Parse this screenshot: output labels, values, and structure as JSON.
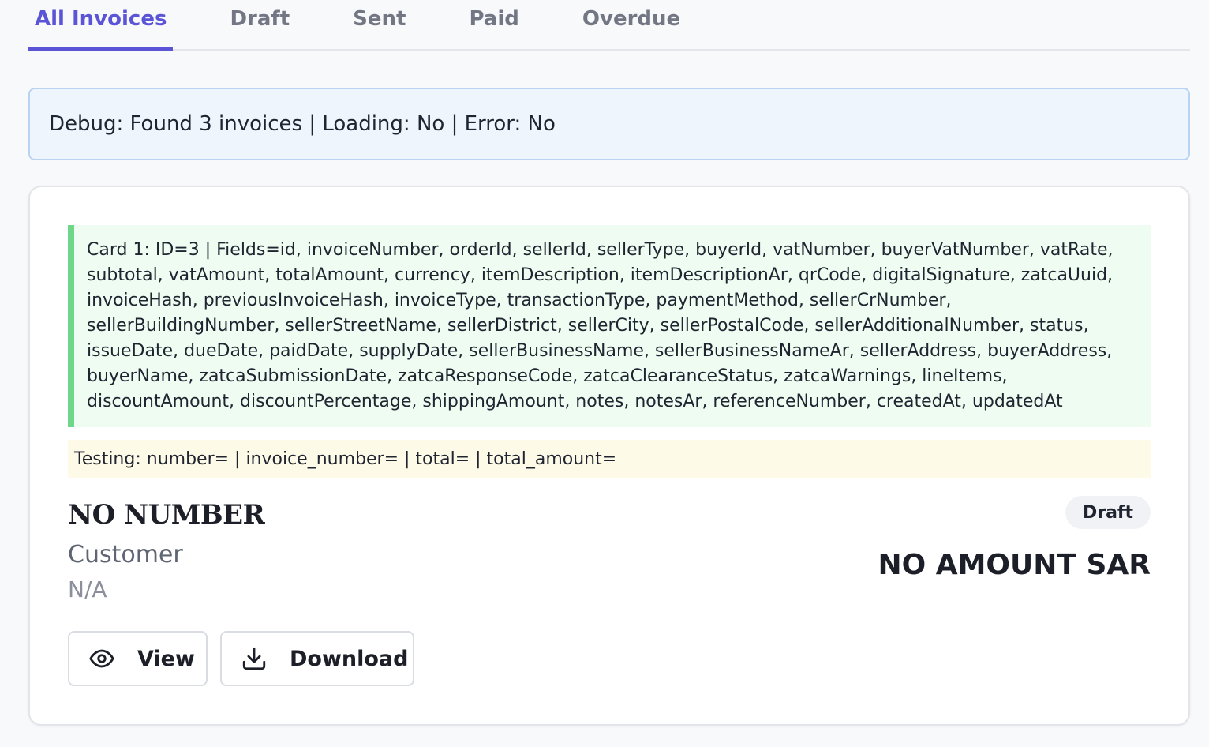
{
  "tabs": [
    {
      "label": "All Invoices",
      "active": true
    },
    {
      "label": "Draft",
      "active": false
    },
    {
      "label": "Sent",
      "active": false
    },
    {
      "label": "Paid",
      "active": false
    },
    {
      "label": "Overdue",
      "active": false
    }
  ],
  "debug": {
    "text": "Debug: Found 3 invoices | Loading: No | Error: No"
  },
  "card": {
    "fields_text": "Card 1: ID=3 | Fields=id, invoiceNumber, orderId, sellerId, sellerType, buyerId, vatNumber, buyerVatNumber, vatRate, subtotal, vatAmount, totalAmount, currency, itemDescription, itemDescriptionAr, qrCode, digitalSignature, zatcaUuid, invoiceHash, previousInvoiceHash, invoiceType, transactionType, paymentMethod, sellerCrNumber, sellerBuildingNumber, sellerStreetName, sellerDistrict, sellerCity, sellerPostalCode, sellerAdditionalNumber, status, issueDate, dueDate, paidDate, supplyDate, sellerBusinessName, sellerBusinessNameAr, sellerAddress, buyerAddress, buyerName, zatcaSubmissionDate, zatcaResponseCode, zatcaClearanceStatus, zatcaWarnings, lineItems, discountAmount, discountPercentage, shippingAmount, notes, notesAr, referenceNumber, createdAt, updatedAt",
    "testing_text": "Testing: number= | invoice_number= | total= | total_amount=",
    "invoice_number": "NO NUMBER",
    "customer_label": "Customer",
    "customer_value": "N/A",
    "status": "Draft",
    "amount": "NO AMOUNT SAR",
    "view_label": "View",
    "download_label": "Download"
  },
  "icons": {
    "view": "eye-icon",
    "download": "download-icon"
  },
  "colors": {
    "accent": "#5b54d6",
    "debug_bg": "#eef5fd",
    "debug_border": "#b9d4f3",
    "fields_bg": "#effcf2",
    "fields_border": "#6fd78a",
    "testing_bg": "#fdfbe8"
  }
}
